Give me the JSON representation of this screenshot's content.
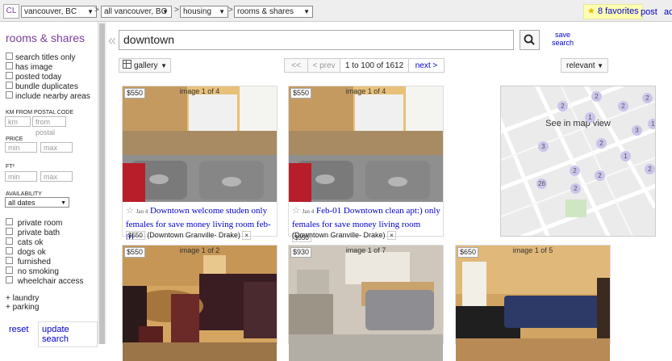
{
  "topbar": {
    "logo": "CL",
    "crumbs": [
      "vancouver, BC",
      "all vancouver, BC",
      "housing",
      "rooms & shares"
    ],
    "sep": ">",
    "favorites": "8 favorites",
    "post": "post",
    "account": "ac"
  },
  "sidebar": {
    "title": "rooms & shares",
    "search_opts": [
      "search titles only",
      "has image",
      "posted today",
      "bundle duplicates",
      "include nearby areas"
    ],
    "km_label": "KM FROM POSTAL CODE",
    "km_placeholder": "km",
    "postal_placeholder": "from postal",
    "price_label": "PRICE",
    "min": "min",
    "max": "max",
    "ft_label": "FT²",
    "availability_label": "AVAILABILITY",
    "availability_value": "all dates",
    "room_opts": [
      "private room",
      "private bath",
      "cats ok",
      "dogs ok",
      "furnished",
      "no smoking",
      "wheelchair access"
    ],
    "more": [
      "laundry",
      "parking"
    ],
    "reset": "reset",
    "update": "update search"
  },
  "search": {
    "value": "downtown",
    "save": "save",
    "search_word": "search"
  },
  "toolbar": {
    "view": "gallery",
    "first": "<<",
    "prev": "< prev",
    "range": "1 to 100 of 1612",
    "next": "next >",
    "sort": "relevant"
  },
  "cards": [
    {
      "price": "$550",
      "image_count": "image 1 of 4",
      "date": "Jan 4",
      "title": "Downtown welcome studen only females for save money living room feb-01",
      "meta_price": "$550",
      "location": "(Downtown Granville- Drake)"
    },
    {
      "price": "$550",
      "image_count": "image 1 of 4",
      "date": "Jan 4",
      "title": "Feb-01 Downtown clean apt:) only females for save money living room",
      "meta_price": "$550",
      "location": "(Downtown Granville- Drake)"
    },
    {
      "price": "$550",
      "image_count": "image 1 of 2"
    },
    {
      "price": "$930",
      "image_count": "image 1 of 7"
    },
    {
      "price": "$650",
      "image_count": "image 1 of 5"
    }
  ],
  "map": {
    "label": "See in map view",
    "clusters": [
      "2",
      "2",
      "2",
      "3",
      "2",
      "1",
      "2",
      "2",
      "26",
      "2",
      "2",
      "1",
      "3",
      "2",
      "1"
    ]
  },
  "icons": {
    "close": "×",
    "star": "☆",
    "fav_star": "★",
    "caret": "▾",
    "plus": "+"
  }
}
